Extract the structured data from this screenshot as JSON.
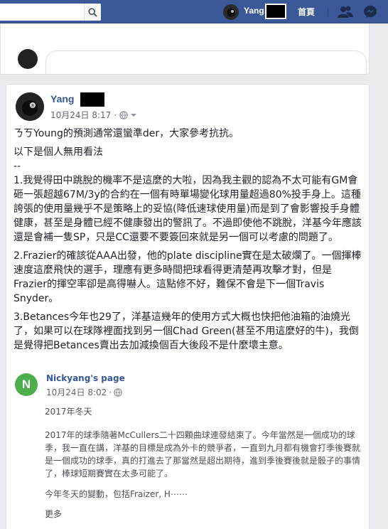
{
  "topbar": {
    "user_name": "Yang",
    "home_label": "首頁"
  },
  "post": {
    "author": "Yang",
    "date": "10月24日 8:17",
    "dot": "·",
    "paragraphs": [
      "ㄋㄎYoung的預測通常還蠻準der，大家參考抗抗。",
      "以下是個人無用看法",
      "--",
      "1.我覺得田中跳脫的機率不是這麼的大啦，因為我主觀的認為不太可能有GM會砸一張超越67M/3y的合約在一個有時單場變化球用量超過80%投手身上。這種誇張的使用量幾乎不是策略上的妥協(降低速球使用量)而是到了會影響投手身體健康，甚至是身體已經不健康發出的警訊了。不過即使他不跳脫，洋基今年應該還是會補一隻SP，只是CC還要不要簽回來就是另一個可以考慮的問題了。",
      "2.Frazier的確該從AAA出發，他的plate discipline實在是太破爛了。一個揮棒速度這麼飛快的選手，理應有更多時間把球看得更清楚再攻擊才對，但是Frazier的揮空率卻是高得嚇人。這點修不好，難保不會是下一個Travis Snyder。",
      "3.Betances今年也29了，洋基這幾年的使用方式大概也快把他油箱的油燒光了，如果可以在球隊裡面找到另一個Chad Green(甚至不用這麼好的牛)，我倒是覺得把Betances賣出去加減換個百大後段不是什麼壞主意。"
    ]
  },
  "shared": {
    "logo_letter": "N",
    "page_name": "Nickyang's page",
    "date": "10月24日 8:02",
    "dot": "·",
    "title": "2017年冬天",
    "paragraph": "2017年的球季隨著McCullers二十四顆曲球連發結束了。今年當然是一個成功的球季，我一直在講，洋基的目標是成為外卡的競爭者，一直到九月都有機會打季後賽就是一個成功的球季，真的打進去了那當然是超出期待，進到季後賽後就是骰子的事情了，棒球短期賽實在太多可能了。",
    "teaser": "今年冬天的變動，包括Fraizer, H⋯⋯",
    "more_label": "更多"
  },
  "colors": {
    "topbar": "#3b5998",
    "link": "#365899",
    "page_logo": "#4cae4c"
  },
  "icons": [
    "search-icon",
    "friends-icon",
    "messenger-icon",
    "globe-icon",
    "caret-down-icon"
  ]
}
